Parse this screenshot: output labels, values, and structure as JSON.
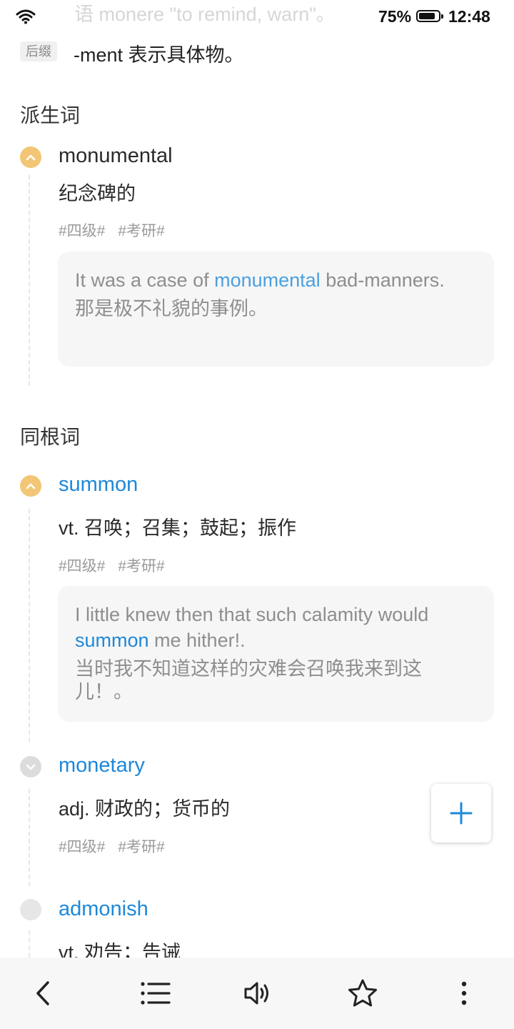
{
  "status_bar": {
    "ghost_text": "语 monere \"to remind, warn\"。",
    "battery": "75%",
    "battery_level": 0.75,
    "time": "12:48",
    "icons": [
      "wifi-icon",
      "battery-icon"
    ]
  },
  "suffix": {
    "tag": "后缀",
    "text": "-ment 表示具体物。"
  },
  "derived": {
    "title": "派生词",
    "entries": [
      {
        "word": "monumental",
        "meaning": "纪念碑的",
        "tags": [
          "#四级#",
          "#考研#"
        ],
        "example_before": "It was a case of ",
        "example_highlight": "monumental",
        "example_after": " bad-manners.",
        "example_zh": "那是极不礼貌的事例。"
      }
    ]
  },
  "cognates": {
    "title": "同根词",
    "entries": [
      {
        "word": "summon",
        "meaning": "vt. 召唤；召集；鼓起；振作",
        "tags": [
          "#四级#",
          "#考研#"
        ],
        "example_before": "I little knew then that such calamity would ",
        "example_highlight": "summon",
        "example_after": " me hither!.",
        "example_zh": "当时我不知道这样的灾难会召唤我来到这儿！。"
      },
      {
        "word": "monetary",
        "meaning": "adj. 财政的；货币的",
        "tags": [
          "#四级#",
          "#考研#"
        ]
      },
      {
        "word": "admonish",
        "meaning": "vt. 劝告；告诫"
      }
    ]
  },
  "colors": {
    "accent_blue": "#1e88d9",
    "badge_orange": "#f2c675",
    "example_bg": "#f6f6f6"
  },
  "bottom_nav": [
    "back-icon",
    "list-icon",
    "speaker-icon",
    "star-icon",
    "more-icon"
  ],
  "fab_icon": "plus-icon"
}
